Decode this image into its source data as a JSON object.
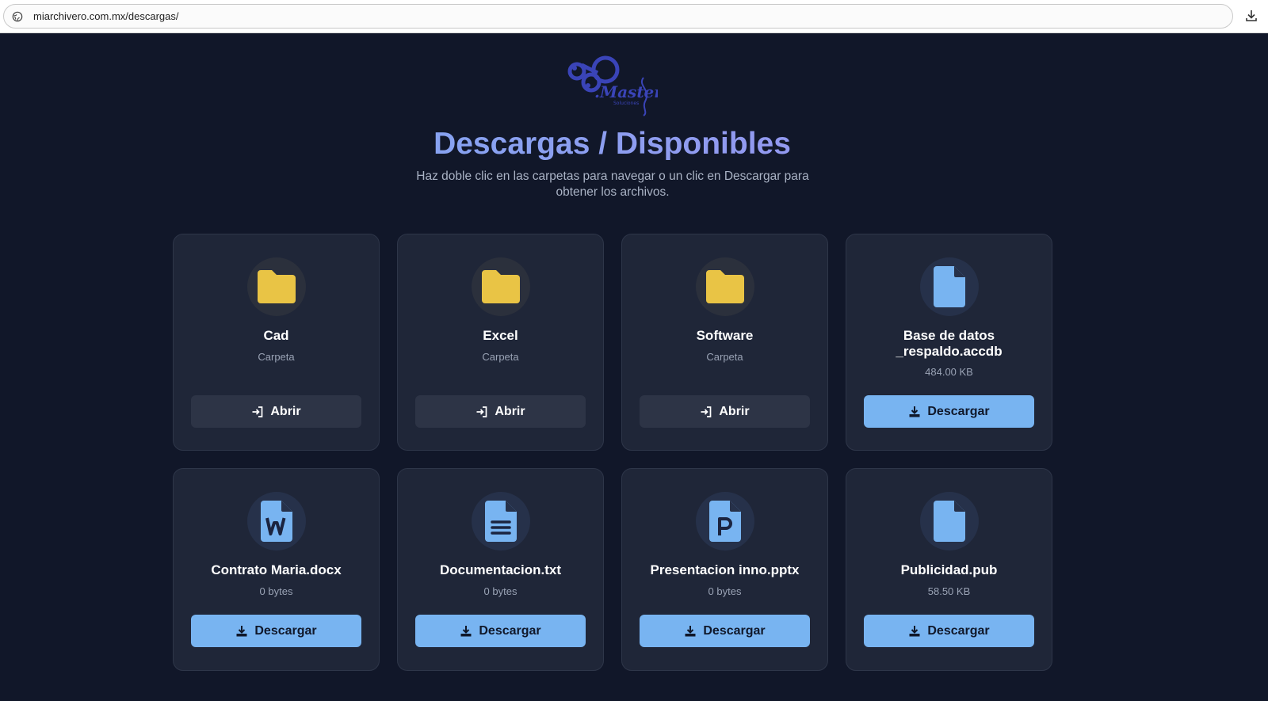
{
  "browser": {
    "url": "miarchivero.com.mx/descargas/"
  },
  "header": {
    "title": "Descargas / Disponibles",
    "subtitle": "Haz doble clic en las carpetas para navegar o un clic en Descargar para obtener los archivos.",
    "logo_text": "Master Soluciones"
  },
  "items": [
    {
      "name": "Cad",
      "meta": "Carpeta",
      "icon": "folder-icon",
      "button": "Abrir"
    },
    {
      "name": "Excel",
      "meta": "Carpeta",
      "icon": "folder-icon",
      "button": "Abrir"
    },
    {
      "name": "Software",
      "meta": "Carpeta",
      "icon": "folder-icon",
      "button": "Abrir"
    },
    {
      "name": "Base de datos _respaldo.accdb",
      "meta": "484.00 KB",
      "icon": "file-icon",
      "button": "Descargar"
    },
    {
      "name": "Contrato Maria.docx",
      "meta": "0 bytes",
      "icon": "word-file-icon",
      "button": "Descargar"
    },
    {
      "name": "Documentacion.txt",
      "meta": "0 bytes",
      "icon": "text-file-icon",
      "button": "Descargar"
    },
    {
      "name": "Presentacion inno.pptx",
      "meta": "0 bytes",
      "icon": "powerpoint-file-icon",
      "button": "Descargar"
    },
    {
      "name": "Publicidad.pub",
      "meta": "58.50 KB",
      "icon": "file-icon",
      "button": "Descargar"
    }
  ],
  "colors": {
    "background": "#111729",
    "card": "#1f2638",
    "folder": "#e9c445",
    "file": "#78b4f1",
    "download_button": "#78b4f1",
    "open_button": "#2d3446"
  }
}
